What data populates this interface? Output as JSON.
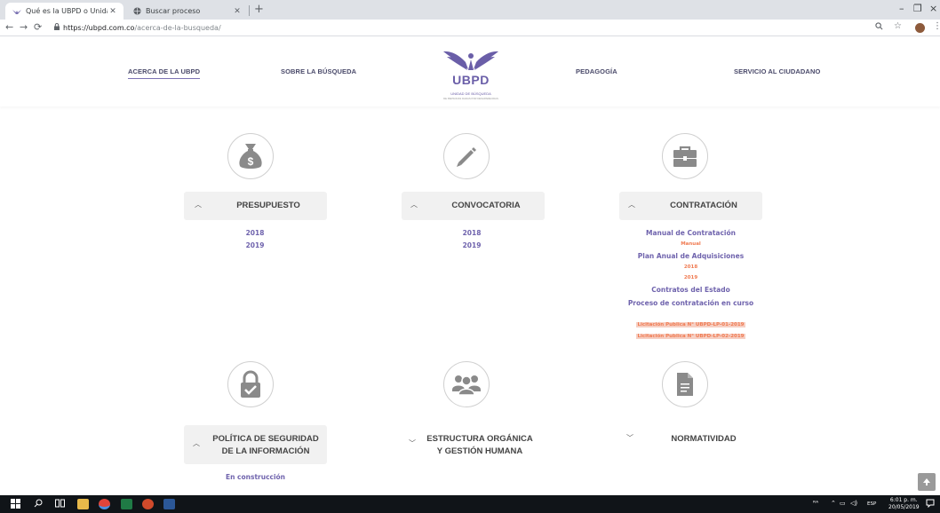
{
  "browser": {
    "tabs": [
      {
        "title": "Qué es la UBPD o Unidad de bús"
      },
      {
        "title": "Buscar proceso"
      }
    ],
    "new_tab": "+",
    "url_host": "https://ubpd.com.co",
    "url_path": "/acerca-de-la-busqueda/",
    "window_controls": {
      "minimize": "–",
      "maximize": "❐",
      "close": "×"
    }
  },
  "header": {
    "nav": [
      {
        "label": "ACERCA DE LA UBPD"
      },
      {
        "label": "SOBRE LA BÚSQUEDA"
      },
      {
        "label": "PEDAGOGÍA"
      },
      {
        "label": "SERVICIO AL CIUDADANO"
      }
    ],
    "logo": {
      "main": "UBPD",
      "sub": "UNIDAD DE BÚSQUEDA",
      "sub2": "DE PERSONAS DADAS POR DESAPARECIDAS"
    }
  },
  "sections": {
    "presupuesto": {
      "title": "PRESUPUESTO",
      "links": [
        "2018",
        "2019"
      ],
      "icon": "money-bag-icon"
    },
    "convocatoria": {
      "title": "CONVOCATORIA",
      "links": [
        "2018",
        "2019"
      ],
      "icon": "pencil-icon"
    },
    "contratacion": {
      "title": "CONTRATACIÓN",
      "icon": "briefcase-icon",
      "manual_title": "Manual de Contratación",
      "manual": "Manual",
      "plan_title": "Plan Anual de Adquisiciones",
      "plan_2018": "2018",
      "plan_2019": "2019",
      "contratos": "Contratos del Estado",
      "proceso": "Proceso de contratación en curso",
      "licitacion_1": "Licitación Publica N° UBPD-LP-01-2019",
      "licitacion_2": "Licitación Publica N° UBPD-LP-02-2019"
    },
    "seguridad": {
      "title_line1": "POLÍTICA DE SEGURIDAD",
      "title_line2": "DE LA INFORMACIÓN",
      "status": "En construcción",
      "icon": "lock-icon"
    },
    "estructura": {
      "title_line1": "ESTRUCTURA ORGÁNICA",
      "title_line2": "Y GESTIÓN HUMANA",
      "icon": "people-icon"
    },
    "normatividad": {
      "title": "NORMATIVIDAD",
      "icon": "document-icon"
    }
  },
  "taskbar": {
    "language": "ESP",
    "time": "6:01 p. m.",
    "date": "20/05/2019"
  },
  "colors": {
    "accent": "#6f63ad",
    "orange": "#f07b52",
    "header_bg": "#f1f1f1",
    "icon_gray": "#8a8a8a"
  }
}
